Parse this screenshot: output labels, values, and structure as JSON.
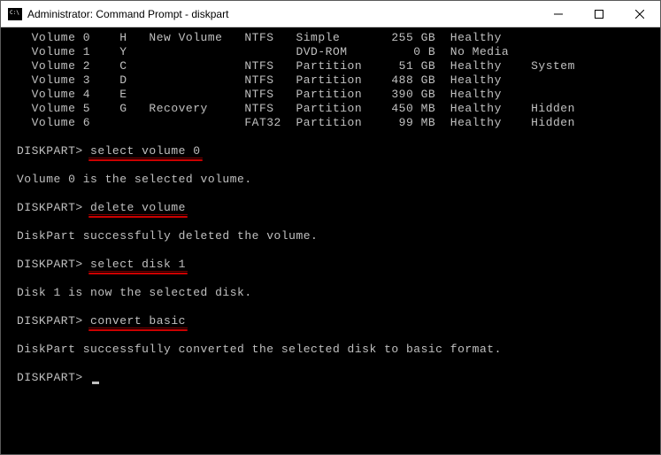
{
  "titlebar": {
    "title": "Administrator: Command Prompt - diskpart"
  },
  "volumes": [
    {
      "num": "0",
      "ltr": "H",
      "label": "New Volume",
      "fs": "NTFS",
      "type": "Simple",
      "size": "255 GB",
      "status": "Healthy",
      "info": ""
    },
    {
      "num": "1",
      "ltr": "Y",
      "label": "",
      "fs": "",
      "type": "DVD-ROM",
      "size": "0 B",
      "status": "No Media",
      "info": ""
    },
    {
      "num": "2",
      "ltr": "C",
      "label": "",
      "fs": "NTFS",
      "type": "Partition",
      "size": "51 GB",
      "status": "Healthy",
      "info": "System"
    },
    {
      "num": "3",
      "ltr": "D",
      "label": "",
      "fs": "NTFS",
      "type": "Partition",
      "size": "488 GB",
      "status": "Healthy",
      "info": ""
    },
    {
      "num": "4",
      "ltr": "E",
      "label": "",
      "fs": "NTFS",
      "type": "Partition",
      "size": "390 GB",
      "status": "Healthy",
      "info": ""
    },
    {
      "num": "5",
      "ltr": "G",
      "label": "Recovery",
      "fs": "NTFS",
      "type": "Partition",
      "size": "450 MB",
      "status": "Healthy",
      "info": "Hidden"
    },
    {
      "num": "6",
      "ltr": "",
      "label": "",
      "fs": "FAT32",
      "type": "Partition",
      "size": "99 MB",
      "status": "Healthy",
      "info": "Hidden"
    }
  ],
  "prompt": "DISKPART>",
  "blocks": [
    {
      "cmd": "select volume 0",
      "response": "Volume 0 is the selected volume."
    },
    {
      "cmd": "delete volume",
      "response": "DiskPart successfully deleted the volume."
    },
    {
      "cmd": "select disk 1",
      "response": "Disk 1 is now the selected disk."
    },
    {
      "cmd": "convert basic",
      "response": "DiskPart successfully converted the selected disk to basic format."
    }
  ]
}
